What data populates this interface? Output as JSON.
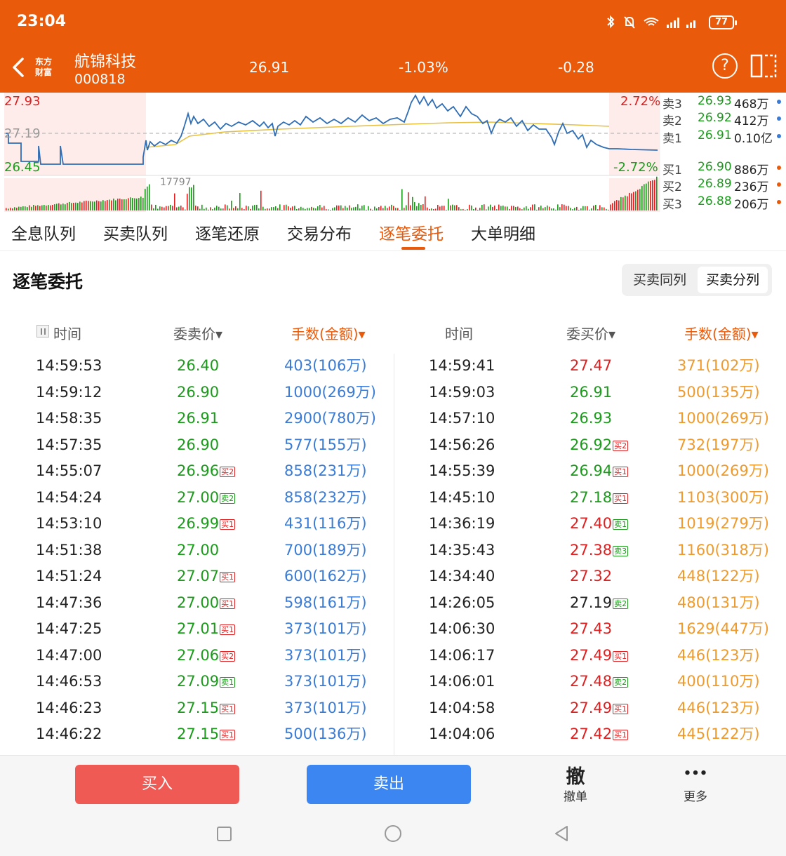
{
  "status": {
    "time": "23:04",
    "battery": "77"
  },
  "header": {
    "logo_line1": "东方",
    "logo_line2": "财富",
    "name": "航锦科技",
    "code": "000818",
    "price": "26.91",
    "pct": "-1.03%",
    "change": "-0.28",
    "help": "?"
  },
  "chart": {
    "high": "27.93",
    "mid": "27.19",
    "low": "26.45",
    "pct_up": "2.72%",
    "pct_down": "-2.72%",
    "volume_label": "17797"
  },
  "orderbook": {
    "sell": [
      {
        "label": "卖3",
        "price": "26.93",
        "volume": "468万"
      },
      {
        "label": "卖2",
        "price": "26.92",
        "volume": "412万"
      },
      {
        "label": "卖1",
        "price": "26.91",
        "volume": "0.10亿"
      }
    ],
    "buy": [
      {
        "label": "买1",
        "price": "26.90",
        "volume": "886万"
      },
      {
        "label": "买2",
        "price": "26.89",
        "volume": "236万"
      },
      {
        "label": "买3",
        "price": "26.88",
        "volume": "206万"
      }
    ]
  },
  "tabs": [
    "全息队列",
    "买卖队列",
    "逐笔还原",
    "交易分布",
    "逐笔委托",
    "大单明细"
  ],
  "section": {
    "title": "逐笔委托",
    "toggle_a": "买卖同列",
    "toggle_b": "买卖分列"
  },
  "table": {
    "head_sell": {
      "time": "时间",
      "price": "委卖价▾",
      "qty": "手数(金额)▾"
    },
    "head_buy": {
      "time": "时间",
      "price": "委买价▾",
      "qty": "手数(金额)▾"
    },
    "sell_rows": [
      {
        "time": "14:59:53",
        "price": "26.40",
        "tag": "",
        "qty": "403(106万)"
      },
      {
        "time": "14:59:12",
        "price": "26.90",
        "tag": "",
        "qty": "1000(269万)"
      },
      {
        "time": "14:58:35",
        "price": "26.91",
        "tag": "",
        "qty": "2900(780万)"
      },
      {
        "time": "14:57:35",
        "price": "26.90",
        "tag": "",
        "qty": "577(155万)"
      },
      {
        "time": "14:55:07",
        "price": "26.96",
        "tag": "买2",
        "qty": "858(231万)"
      },
      {
        "time": "14:54:24",
        "price": "27.00",
        "tag": "卖2",
        "qty": "858(232万)"
      },
      {
        "time": "14:53:10",
        "price": "26.99",
        "tag": "买1",
        "qty": "431(116万)"
      },
      {
        "time": "14:51:38",
        "price": "27.00",
        "tag": "",
        "qty": "700(189万)"
      },
      {
        "time": "14:51:24",
        "price": "27.07",
        "tag": "买1",
        "qty": "600(162万)"
      },
      {
        "time": "14:47:36",
        "price": "27.00",
        "tag": "买1",
        "qty": "598(161万)"
      },
      {
        "time": "14:47:25",
        "price": "27.01",
        "tag": "买1",
        "qty": "373(101万)"
      },
      {
        "time": "14:47:00",
        "price": "27.06",
        "tag": "买2",
        "qty": "373(101万)"
      },
      {
        "time": "14:46:53",
        "price": "27.09",
        "tag": "卖1",
        "qty": "373(101万)"
      },
      {
        "time": "14:46:23",
        "price": "27.15",
        "tag": "买1",
        "qty": "373(101万)"
      },
      {
        "time": "14:46:22",
        "price": "27.15",
        "tag": "买1",
        "qty": "500(136万)"
      }
    ],
    "buy_rows": [
      {
        "time": "14:59:41",
        "price": "27.47",
        "tag": "",
        "qty": "371(102万)"
      },
      {
        "time": "14:59:03",
        "price": "26.91",
        "tag": "",
        "qty": "500(135万)"
      },
      {
        "time": "14:57:10",
        "price": "26.93",
        "tag": "",
        "qty": "1000(269万)"
      },
      {
        "time": "14:56:26",
        "price": "26.92",
        "tag": "买2",
        "qty": "732(197万)"
      },
      {
        "time": "14:55:39",
        "price": "26.94",
        "tag": "买1",
        "qty": "1000(269万)"
      },
      {
        "time": "14:45:10",
        "price": "27.18",
        "tag": "买1",
        "qty": "1103(300万)"
      },
      {
        "time": "14:36:19",
        "price": "27.40",
        "tag": "卖1",
        "qty": "1019(279万)"
      },
      {
        "time": "14:35:43",
        "price": "27.38",
        "tag": "卖3",
        "qty": "1160(318万)"
      },
      {
        "time": "14:34:40",
        "price": "27.32",
        "tag": "",
        "qty": "448(122万)"
      },
      {
        "time": "14:26:05",
        "price": "27.19",
        "tag": "卖2",
        "qty": "480(131万)"
      },
      {
        "time": "14:06:30",
        "price": "27.43",
        "tag": "",
        "qty": "1629(447万)"
      },
      {
        "time": "14:06:17",
        "price": "27.49",
        "tag": "买1",
        "qty": "446(123万)"
      },
      {
        "time": "14:06:01",
        "price": "27.48",
        "tag": "卖2",
        "qty": "400(110万)"
      },
      {
        "time": "14:04:58",
        "price": "27.49",
        "tag": "买1",
        "qty": "446(123万)"
      },
      {
        "time": "14:04:06",
        "price": "27.42",
        "tag": "买1",
        "qty": "445(122万)"
      }
    ]
  },
  "actions": {
    "buy": "买入",
    "sell": "卖出",
    "cancel_icon": "撤",
    "cancel": "撤单",
    "more_icon": "•••",
    "more": "更多"
  },
  "colors": {
    "brand": "#ea5a0b",
    "up": "#e02020",
    "down": "#1a9b1a",
    "qty_sell": "#3a7bd5",
    "qty_buy": "#ef9a2c"
  }
}
